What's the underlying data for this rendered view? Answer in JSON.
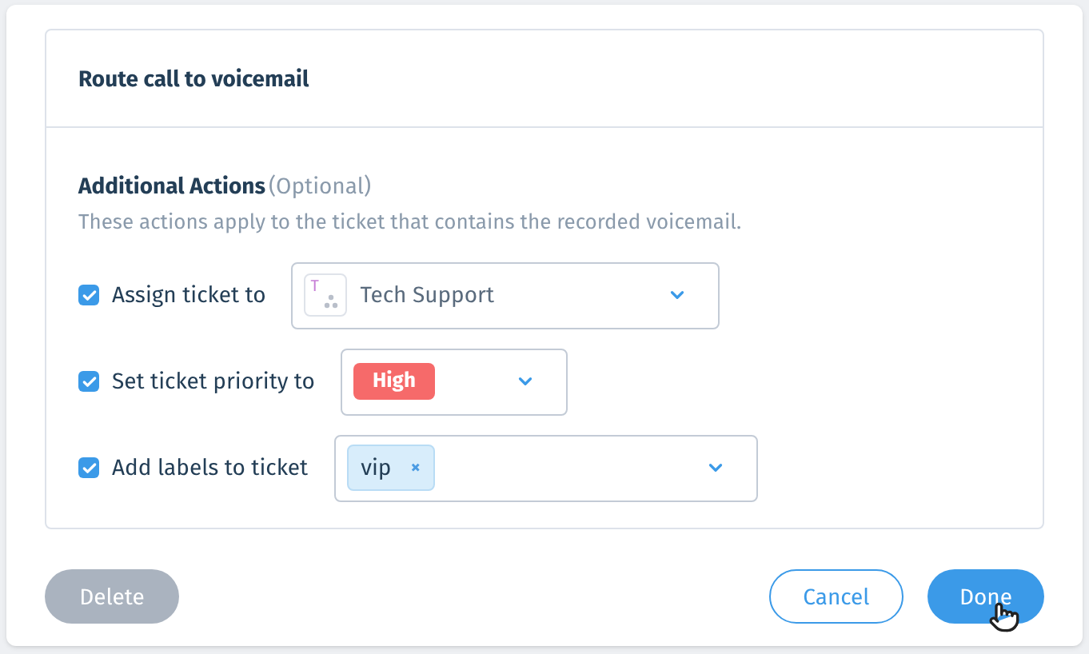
{
  "card": {
    "title": "Route call to voicemail",
    "section": {
      "heading": "Additional Actions",
      "heading_note": "(Optional)",
      "description": "These actions apply to the ticket that contains the recorded voicemail."
    },
    "actions": [
      {
        "label": "Assign ticket to",
        "checked": true,
        "kind": "team",
        "value": "Tech Support",
        "avatar_letter": "T"
      },
      {
        "label": "Set ticket priority to",
        "checked": true,
        "kind": "badge",
        "value": "High",
        "color": "#f66a6a"
      },
      {
        "label": "Add labels to ticket",
        "checked": true,
        "kind": "tags",
        "tags": [
          "vip"
        ],
        "remove_symbol": "×"
      }
    ]
  },
  "buttons": [
    {
      "label": "Delete",
      "kind": "danger",
      "disabled": true
    },
    {
      "label": "Cancel",
      "kind": "outline",
      "disabled": false
    },
    {
      "label": "Done",
      "kind": "primary",
      "disabled": false
    }
  ]
}
